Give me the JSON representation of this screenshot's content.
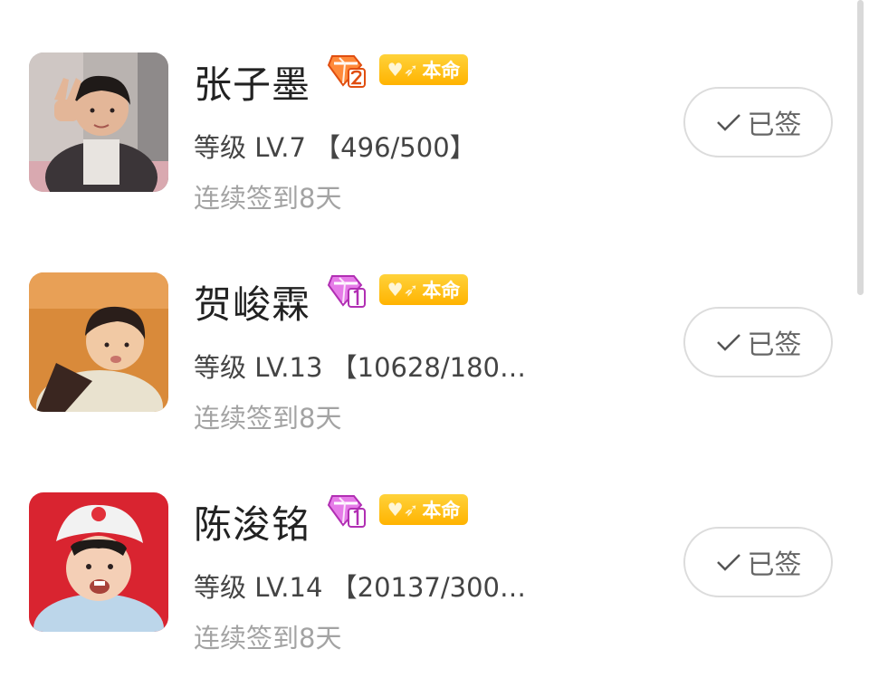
{
  "users": [
    {
      "name": "张子墨",
      "gem": "orange-diamond-level-icon",
      "gem_color": "#ff6a2a",
      "badge_label": "本命",
      "level_text": "等级 LV.7 【496/500】",
      "streak_text": "连续签到8天",
      "button_label": "已签",
      "avatar": "avatar-boy-peace-sign"
    },
    {
      "name": "贺峻霖",
      "gem": "purple-diamond-level-icon",
      "gem_color": "#d84bd9",
      "badge_label": "本命",
      "level_text": "等级 LV.13 【10628/180…",
      "streak_text": "连续签到8天",
      "button_label": "已签",
      "avatar": "avatar-boy-orange-background"
    },
    {
      "name": "陈浚铭",
      "gem": "purple-diamond-level-icon",
      "gem_color": "#d84bd9",
      "badge_label": "本命",
      "level_text": "等级 LV.14 【20137/300…",
      "streak_text": "连续签到8天",
      "button_label": "已签",
      "avatar": "avatar-boy-red-background"
    }
  ],
  "colors": {
    "badge": "#ffc107",
    "name_text": "#222222",
    "level_text": "#444444",
    "streak_text": "#a3a3a3",
    "button_border": "#dcdcdc"
  }
}
